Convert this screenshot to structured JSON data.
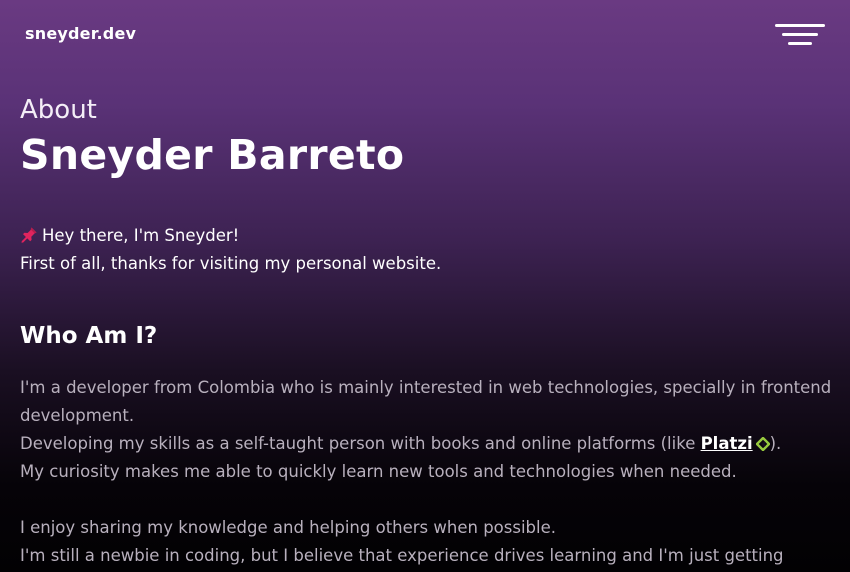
{
  "header": {
    "logo": "sneyder.dev",
    "menu_icon": "hamburger-menu-icon"
  },
  "hero": {
    "kicker": "About",
    "name": "Sneyder Barreto"
  },
  "intro": {
    "pin_icon": "pushpin-icon",
    "greeting": "Hey there, I'm Sneyder!",
    "thanks": "First of all, thanks for visiting my personal website."
  },
  "who": {
    "title": "Who Am I?",
    "p1_line1": "I'm a developer from Colombia who is mainly interested in web technologies, specially in frontend",
    "p1_line2": "development.",
    "p2_prefix": "Developing my skills as a self-taught person with books and online platforms (like ",
    "p2_link": "Platzi",
    "p2_link_icon": "platzi-icon",
    "p2_suffix": ").",
    "p3": "My curiosity makes me able to quickly learn new tools and technologies when needed.",
    "p4": "I enjoy sharing my knowledge and helping others when possible.",
    "p5": "I'm still a newbie in coding, but I believe that experience drives learning and I'm just getting"
  },
  "colors": {
    "background_top": "#6a3a82",
    "background_bottom": "#020103",
    "platzi_green": "#98ca3f",
    "pin_red": "#e0245e"
  }
}
